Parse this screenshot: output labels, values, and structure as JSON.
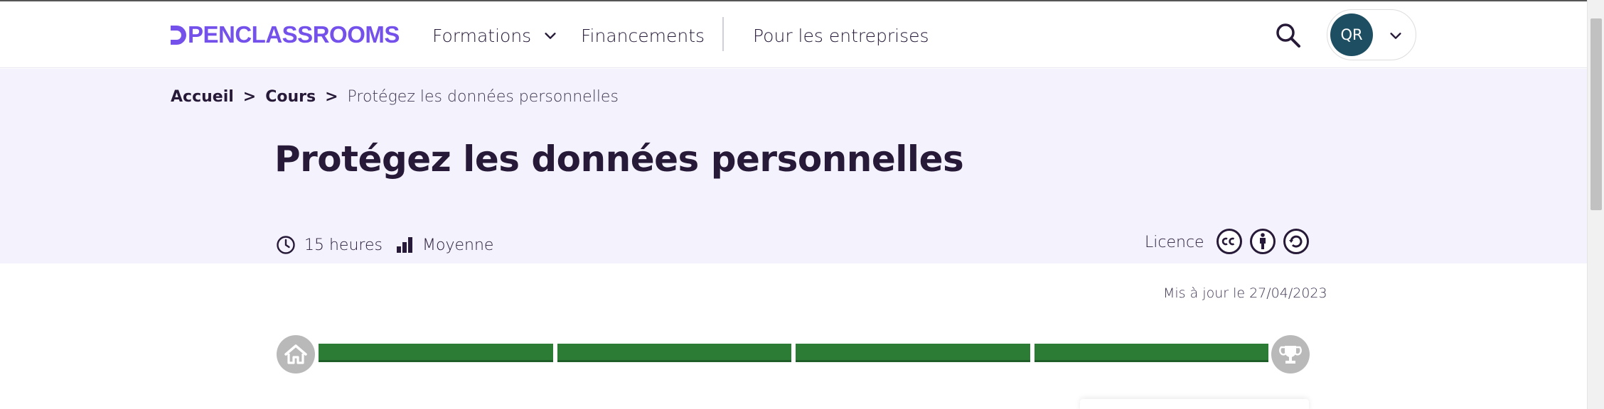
{
  "header": {
    "logo_text": "PENCLASSROOMS",
    "nav": {
      "formations": "Formations",
      "financements": "Financements",
      "entreprises": "Pour les entreprises"
    },
    "user_initials": "QR"
  },
  "breadcrumb": {
    "home": "Accueil",
    "separator": ">",
    "courses": "Cours",
    "current": "Protégez les données personnelles"
  },
  "course": {
    "title": "Protégez les données personnelles",
    "duration": "15 heures",
    "level": "Moyenne",
    "licence_label": "Licence",
    "updated": "Mis à jour le 27/04/2023"
  },
  "progress": {
    "parts_completed": 4,
    "parts_total": 4
  },
  "colors": {
    "brand": "#7451eb",
    "text": "#271a38",
    "hero_bg": "#f4f3fd",
    "progress_done": "#2c7c36",
    "avatar_bg": "#1d4e61"
  },
  "icons": [
    "chevron-down-icon",
    "search-icon",
    "clock-icon",
    "level-bars-icon",
    "cc-icon",
    "by-icon",
    "sa-icon",
    "home-icon",
    "trophy-icon"
  ]
}
